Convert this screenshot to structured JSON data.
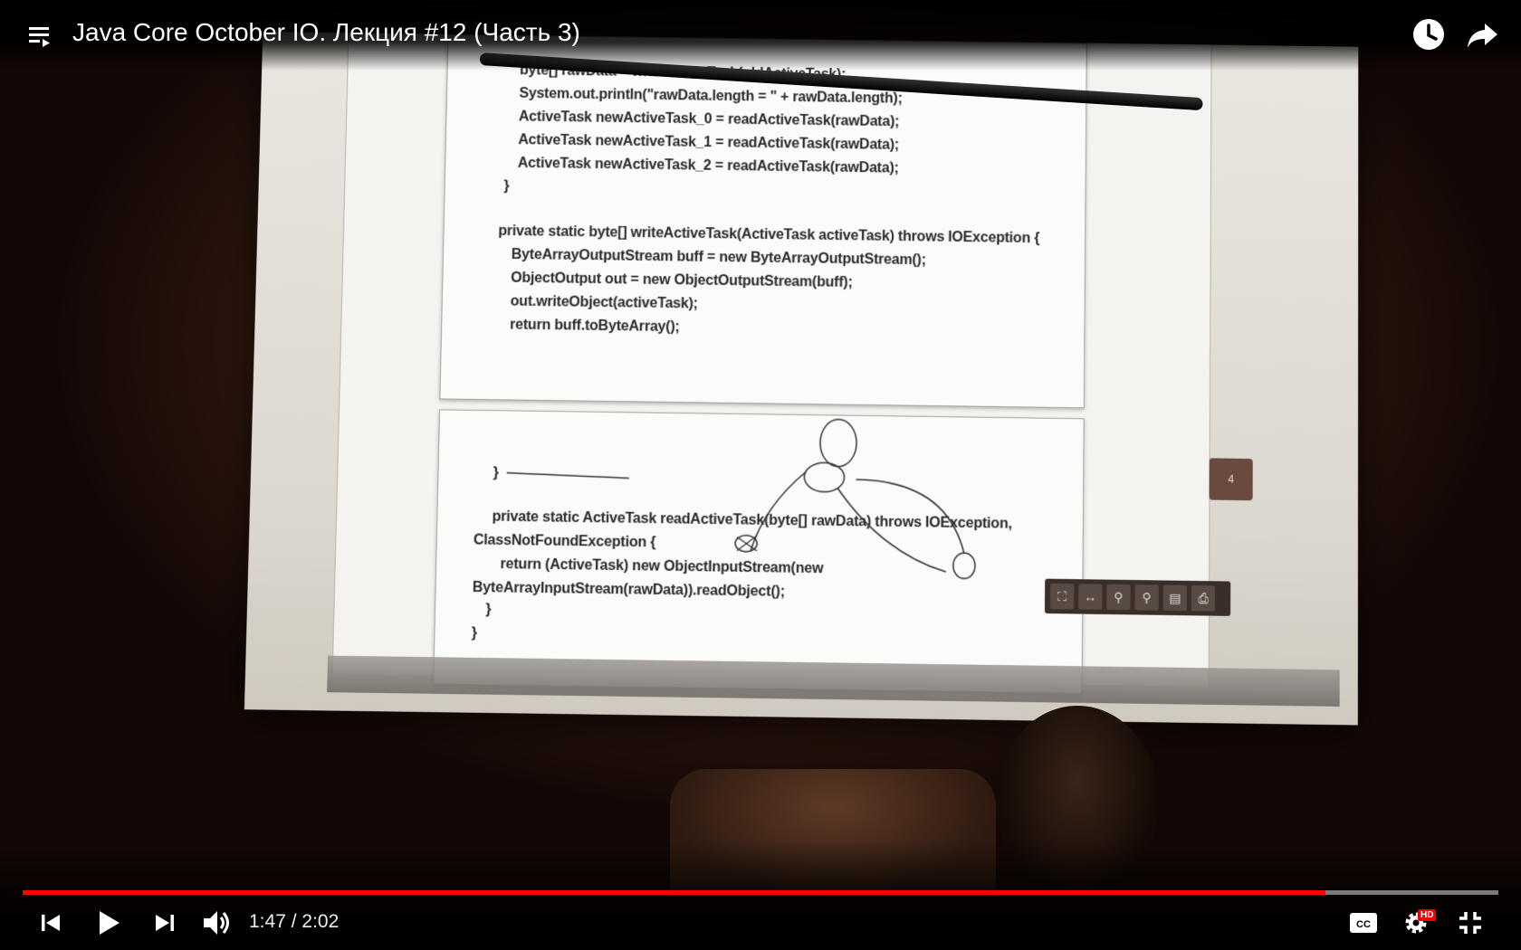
{
  "player": {
    "title": "Java Core October IO. Лекция #12 (Часть 3)",
    "time": {
      "current": "1:47",
      "separator": " / ",
      "duration": "2:02"
    },
    "progress_fraction": 0.883,
    "hd_badge": "HD"
  },
  "slide": {
    "page1_lines": [
      "byte[] rawData = writeActiveTask(oldActiveTask);",
      "System.out.println(\"rawData.length = \" + rawData.length);",
      "ActiveTask newActiveTask_0 = readActiveTask(rawData);",
      "ActiveTask newActiveTask_1 = readActiveTask(rawData);",
      "ActiveTask newActiveTask_2 = readActiveTask(rawData);",
      "}",
      "private static byte[] writeActiveTask(ActiveTask activeTask) throws IOException {",
      "ByteArrayOutputStream buff = new ByteArrayOutputStream();",
      "ObjectOutput out = new ObjectOutputStream(buff);",
      "out.writeObject(activeTask);",
      "return buff.toByteArray();"
    ],
    "page2_lines": [
      "}",
      "private static ActiveTask readActiveTask(byte[] rawData) throws IOException,",
      "ClassNotFoundException {",
      "return (ActiveTask) new ObjectInputStream(new",
      "ByteArrayInputStream(rawData)).readObject();",
      "}",
      "}"
    ],
    "page_number": "4"
  },
  "icons": {
    "playlist": "playlist-icon",
    "watch_later": "clock-icon",
    "share": "share-icon",
    "previous": "previous-icon",
    "play": "play-icon",
    "next": "next-icon",
    "volume": "volume-icon",
    "captions": "captions-icon",
    "settings": "gear-icon",
    "exit_fullscreen": "exit-fullscreen-icon"
  },
  "colors": {
    "progress_played": "#ff0000",
    "progress_track": "#7a7a7a",
    "hd_badge": "#ee0000"
  }
}
